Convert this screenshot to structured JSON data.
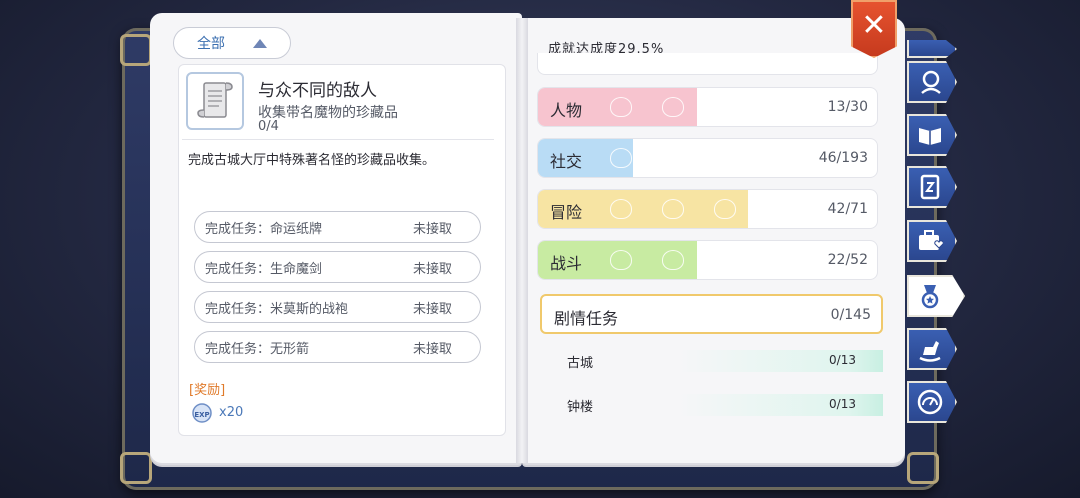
{
  "left_page": {
    "filter": {
      "label": "全部"
    },
    "item": {
      "title": "与众不同的敌人",
      "subtitle": "收集带名魔物的珍藏品",
      "progress": "0/4",
      "description": "完成古城大厅中特殊著名怪的珍藏品收集。"
    },
    "tasks": [
      {
        "name": "完成任务：命运纸牌",
        "status": "未接取"
      },
      {
        "name": "完成任务：生命魔剑",
        "status": "未接取"
      },
      {
        "name": "完成任务：米莫斯的战袍",
        "status": "未接取"
      },
      {
        "name": "完成任务：无形箭",
        "status": "未接取"
      }
    ],
    "reward": {
      "label": "[奖励]",
      "count": "x20",
      "icon": "exp-icon"
    }
  },
  "right_page": {
    "completion": "成就达成度29.5%",
    "categories": [
      {
        "label": "人物",
        "count": "13/30",
        "fill": 0.47,
        "color": "#f7c4cf"
      },
      {
        "label": "社交",
        "count": "46/193",
        "fill": 0.28,
        "color": "#b9dcf5"
      },
      {
        "label": "冒险",
        "count": "42/71",
        "fill": 0.62,
        "color": "#f7e4a3"
      },
      {
        "label": "战斗",
        "count": "22/52",
        "fill": 0.47,
        "color": "#c8eba2"
      }
    ],
    "story": {
      "label": "剧情任务",
      "count": "0/145"
    },
    "subcategories": [
      {
        "label": "古城",
        "count": "0/13"
      },
      {
        "label": "钟楼",
        "count": "0/13"
      }
    ]
  },
  "controls": {
    "close": "✕"
  },
  "side_tabs": [
    {
      "icon": "cropped-tab-icon"
    },
    {
      "icon": "portrait-icon"
    },
    {
      "icon": "book-icon"
    },
    {
      "icon": "card-icon"
    },
    {
      "icon": "briefcase-heart-icon"
    },
    {
      "icon": "medal-icon",
      "active": true
    },
    {
      "icon": "rocking-horse-icon"
    },
    {
      "icon": "gauge-icon"
    }
  ]
}
